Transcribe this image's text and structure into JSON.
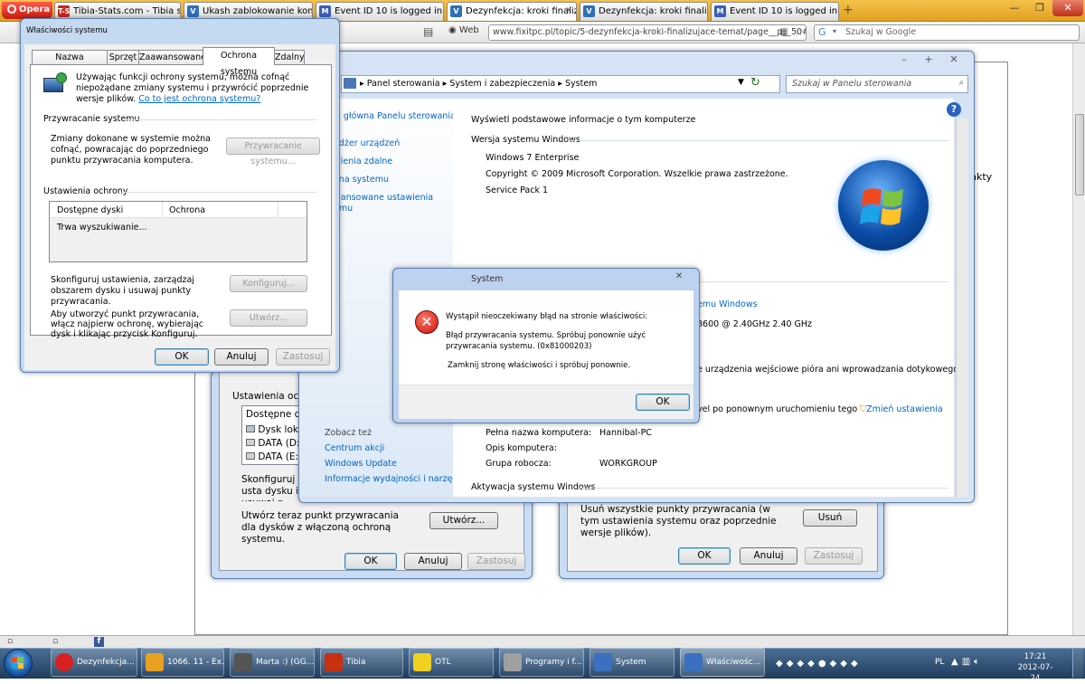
{
  "browser": {
    "menu_label": "Opera",
    "tabs": [
      {
        "label": "Tibia-Stats.com - Tibia sta...",
        "fav_color": "#c8281e",
        "fav_text": "T-S"
      },
      {
        "label": "Ukash zablokowanie kom...",
        "fav_color": "#2e6fb8",
        "fav_text": "V"
      },
      {
        "label": "Event ID 10 is logged in th...",
        "fav_color": "#3a5fb8",
        "fav_text": "M"
      },
      {
        "label": "Dezynfekcja: kroki finalizuj...",
        "fav_color": "#2e6fb8",
        "fav_text": "V"
      },
      {
        "label": "Dezynfekcja: kroki finalizuj...",
        "fav_color": "#2e6fb8",
        "fav_text": "V"
      },
      {
        "label": "Event ID 10 is logged in th...",
        "fav_color": "#3a5fb8",
        "fav_text": "M"
      }
    ],
    "web_label": "Web",
    "url": "www.fixitpc.pl/topic/5-dezynfekcja-kroki-finalizujace-temat/page__p__50#entry$",
    "search_placeholder": "Szukaj w Google",
    "page_fragment_text": "unkty"
  },
  "sysprops": {
    "title": "Właściwości systemu",
    "tabs": [
      "Nazwa komputera",
      "Sprzęt",
      "Zaawansowane",
      "Ochrona systemu",
      "Zdalny"
    ],
    "intro": "Używając funkcji ochrony systemu, można cofnąć niepożądane zmiany systemu i przywrócić poprzednie wersje plików.",
    "intro_link": "Co to jest ochrona systemu?",
    "restore_header": "Przywracanie systemu",
    "restore_desc": "Zmiany dokonane w systemie można cofnąć, powracając do poprzedniego punktu przywracania komputera.",
    "restore_button": "Przywracanie systemu...",
    "settings_header": "Ustawienia ochrony",
    "col_disks": "Dostępne dyski",
    "col_protection": "Ochrona",
    "searching": "Trwa wyszukiwanie...",
    "configure_desc": "Skonfiguruj ustawienia, zarządzaj obszarem dysku i usuwaj punkty przywracania.",
    "configure_button": "Konfiguruj...",
    "create_desc": "Aby utworzyć punkt przywracania, włącz najpierw ochronę, wybierając dysk i klikając przycisk Konfiguruj.",
    "create_button": "Utwórz...",
    "ok": "OK",
    "cancel": "Anuluj",
    "apply": "Zastosuj"
  },
  "bg_dialog_left": {
    "settings_header": "Ustawienia ochron",
    "col_disks": "Dostępne dysk",
    "disks": [
      "Dysk lokaln",
      "DATA (D:)",
      "DATA (E:)"
    ],
    "configure_desc": "Skonfiguruj usta dysku i usuwaj p",
    "create_desc": "Utwórz teraz punkt przywracania dla dysków z włączoną ochroną systemu.",
    "create_button": "Utwórz...",
    "ok": "OK",
    "cancel": "Anuluj",
    "apply": "Zastosuj"
  },
  "bg_dialog_right": {
    "delete_desc": "Usuń wszystkie punkty przywracania (w tym ustawienia systemu oraz poprzednie wersje plików).",
    "delete_button": "Usuń",
    "ok": "OK",
    "cancel": "Anuluj",
    "apply": "Zastosuj"
  },
  "control_panel": {
    "breadcrumb": [
      "Panel sterowania",
      "System i zabezpieczenia",
      "System"
    ],
    "search_placeholder": "Szukaj w Panelu sterowania",
    "sidebar": [
      "Strona główna Panelu sterowania",
      "Menedżer urządzeń",
      "Ustawienia zdalne",
      "Ochrona systemu",
      "Zaawansowane ustawienia systemu"
    ],
    "sidebar_visible": [
      "a główna Panelu sterowania",
      "edżer urządzeń",
      "wienia zdalne",
      "ona systemu",
      "wansowane ustawienia",
      "emu"
    ],
    "see_also": "Zobacz też",
    "see_also_links": [
      "Centrum akcji",
      "Windows Update",
      "Informacje wydajności i narzędzia"
    ],
    "heading": "Wyświetl podstawowe informacje o tym komputerze",
    "edition_header": "Wersja systemu Windows",
    "edition": "Windows 7 Enterprise",
    "copyright": "Copyright © 2009 Microsoft Corporation. Wszelkie prawa zastrzeżone.",
    "service_pack": "Service Pack 1",
    "system_header": "System",
    "rating_link": "emu Windows",
    "processor": "8600 @ 2.40GHz  2.40 GHz",
    "pen": "e urządzenia wejściowe pióra ani wprowadzania dotykowego",
    "domain_note": "vel po ponownym uruchomieniu tego",
    "change_settings": "Zmień ustawienia",
    "full_name_label": "Pełna nazwa komputera:",
    "full_name": "Hannibal-PC",
    "desc_label": "Opis komputera:",
    "workgroup_label": "Grupa robocza:",
    "workgroup": "WORKGROUP",
    "activation_header": "Aktywacja systemu Windows"
  },
  "error_dialog": {
    "title": "System",
    "line1": "Wystąpił nieoczekiwany błąd na stronie właściwości:",
    "line2": "Błąd przywracania systemu. Spróbuj ponownie użyć przywracania systemu. (0x81000203)",
    "line3": "Zamknij stronę właściwości i spróbuj ponownie.",
    "ok": "OK"
  },
  "taskbar": {
    "items": [
      {
        "label": "Dezynfekcja...",
        "color": "#d82020"
      },
      {
        "label": "1066. 11 - Ex...",
        "color": "#e8a020"
      },
      {
        "label": "Marta :) (GG...",
        "color": "#555555"
      },
      {
        "label": "Tibia",
        "color": "#c83010"
      },
      {
        "label": "OTL",
        "color": "#f0d020"
      },
      {
        "label": "Programy i f...",
        "color": "#a0a0a0"
      },
      {
        "label": "System",
        "color": "#3a70c0"
      },
      {
        "label": "Właściwośc...",
        "color": "#3a70c0"
      }
    ],
    "lang": "PL",
    "time": "17:21",
    "date": "2012-07-24"
  }
}
